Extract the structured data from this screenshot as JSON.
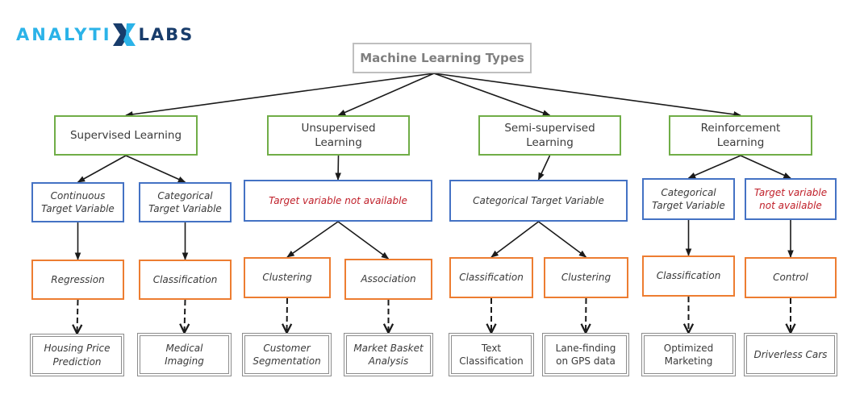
{
  "logo": {
    "part1": "ANALYTI",
    "part2": "LABS",
    "icon": "x-mark-logo-icon",
    "colors": {
      "light": "#2bb3e8",
      "dark": "#183c6b"
    }
  },
  "diagram": {
    "root": {
      "id": "root",
      "label": "Machine Learning Types"
    },
    "categories": [
      {
        "id": "sup",
        "label": "Supervised Learning"
      },
      {
        "id": "unsup",
        "label": "Unsupervised\nLearning"
      },
      {
        "id": "semi",
        "label": "Semi-supervised\nLearning"
      },
      {
        "id": "rl",
        "label": "Reinforcement\nLearning"
      }
    ],
    "targets": [
      {
        "id": "t1",
        "parent": "sup",
        "label": "Continuous\nTarget Variable",
        "highlight": false
      },
      {
        "id": "t2",
        "parent": "sup",
        "label": "Categorical\nTarget Variable",
        "highlight": false
      },
      {
        "id": "t3",
        "parent": "unsup",
        "label": "Target variable not available",
        "highlight": true
      },
      {
        "id": "t4",
        "parent": "semi",
        "label": "Categorical Target Variable",
        "highlight": false
      },
      {
        "id": "t5",
        "parent": "rl",
        "label": "Categorical\nTarget Variable",
        "highlight": false
      },
      {
        "id": "t6",
        "parent": "rl",
        "label": "Target variable\nnot available",
        "highlight": true
      }
    ],
    "tasks": [
      {
        "id": "k1",
        "parent": "t1",
        "label": "Regression"
      },
      {
        "id": "k2",
        "parent": "t2",
        "label": "Classification"
      },
      {
        "id": "k3",
        "parent": "t3",
        "label": "Clustering"
      },
      {
        "id": "k4",
        "parent": "t3",
        "label": "Association"
      },
      {
        "id": "k5",
        "parent": "t4",
        "label": "Classification"
      },
      {
        "id": "k6",
        "parent": "t4",
        "label": "Clustering"
      },
      {
        "id": "k7",
        "parent": "t5",
        "label": "Classification"
      },
      {
        "id": "k8",
        "parent": "t6",
        "label": "Control"
      }
    ],
    "examples": [
      {
        "id": "e1",
        "parent": "k1",
        "label": "Housing Price\nPrediction",
        "italic": true
      },
      {
        "id": "e2",
        "parent": "k2",
        "label": "Medical\nImaging",
        "italic": true
      },
      {
        "id": "e3",
        "parent": "k3",
        "label": "Customer\nSegmentation",
        "italic": true
      },
      {
        "id": "e4",
        "parent": "k4",
        "label": "Market Basket\nAnalysis",
        "italic": true
      },
      {
        "id": "e5",
        "parent": "k5",
        "label": "Text\nClassification",
        "italic": false
      },
      {
        "id": "e6",
        "parent": "k6",
        "label": "Lane-finding\non GPS data",
        "italic": false
      },
      {
        "id": "e7",
        "parent": "k7",
        "label": "Optimized\nMarketing",
        "italic": false
      },
      {
        "id": "e8",
        "parent": "k8",
        "label": "Driverless Cars",
        "italic": true
      }
    ],
    "colors": {
      "root_border": "#bfbfbf",
      "category_border": "#70ad47",
      "target_border": "#4472c4",
      "task_border": "#ed7d31",
      "example_border": "#8c8c8c",
      "highlight_text": "#c0202a"
    }
  }
}
